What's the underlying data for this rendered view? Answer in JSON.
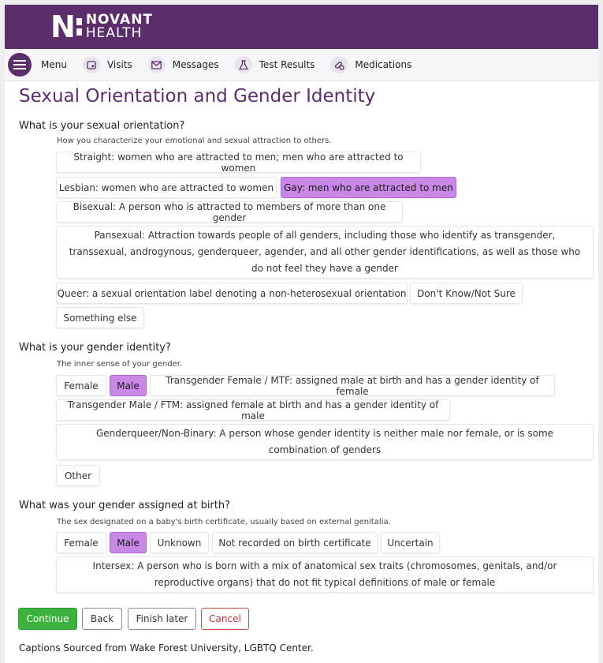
{
  "brand": {
    "letter": "N",
    "line1": "NOVANT",
    "line2": "HEALTH",
    "color": "#5b2d6b"
  },
  "nav": {
    "menu": "Menu",
    "visits": "Visits",
    "messages": "Messages",
    "test_results": "Test Results",
    "medications": "Medications"
  },
  "page": {
    "title": "Sexual Orientation and Gender Identity"
  },
  "orientation": {
    "question": "What is your sexual orientation?",
    "description": "How you characterize your emotional and sexual attraction to others.",
    "options": [
      "Straight: women who are attracted to men; men who are attracted to women",
      "Lesbian: women who are attracted to women",
      "Gay: men who are attracted to men",
      "Bisexual: A person who is attracted to members of more than one gender",
      "Pansexual: Attraction towards people of all genders, including those who identify as transgender, transsexual, androgynous, genderqueer, agender, and all other gender identifications, as well as those who do not feel they have a gender",
      "Queer: a sexual orientation label denoting a non-heterosexual orientation",
      "Don't Know/Not Sure",
      "Something else"
    ],
    "selected": "Gay: men who are attracted to men"
  },
  "gender_identity": {
    "question": "What is your gender identity?",
    "description": "The inner sense of your gender.",
    "options": [
      "Female",
      "Male",
      "Transgender Female / MTF: assigned male at birth and has a gender identity of female",
      "Transgender Male / FTM: assigned female at birth and has a gender identity of male",
      "Genderqueer/Non-Binary: A person whose gender identity is neither male nor female, or is some combination of genders",
      "Other"
    ],
    "selected": "Male"
  },
  "birth_gender": {
    "question": "What was your gender assigned at birth?",
    "description": "The sex designated on a baby's birth certificate, usually based on external genitalia.",
    "options": [
      "Female",
      "Male",
      "Unknown",
      "Not recorded on birth certificate",
      "Uncertain",
      "Intersex: A person who is born with a mix of anatomical sex traits (chromosomes, genitals, and/or reproductive organs) that do not fit typical definitions of male or female"
    ],
    "selected": "Male"
  },
  "actions": {
    "continue": "Continue",
    "back": "Back",
    "finish_later": "Finish later",
    "cancel": "Cancel"
  },
  "footer": {
    "caption": "Captions Sourced from Wake Forest University, LGBTQ Center."
  },
  "colors": {
    "header": "#5b2d6b",
    "selected": "#c987e6",
    "continue": "#3bb23b",
    "cancel": "#c84b4b"
  }
}
